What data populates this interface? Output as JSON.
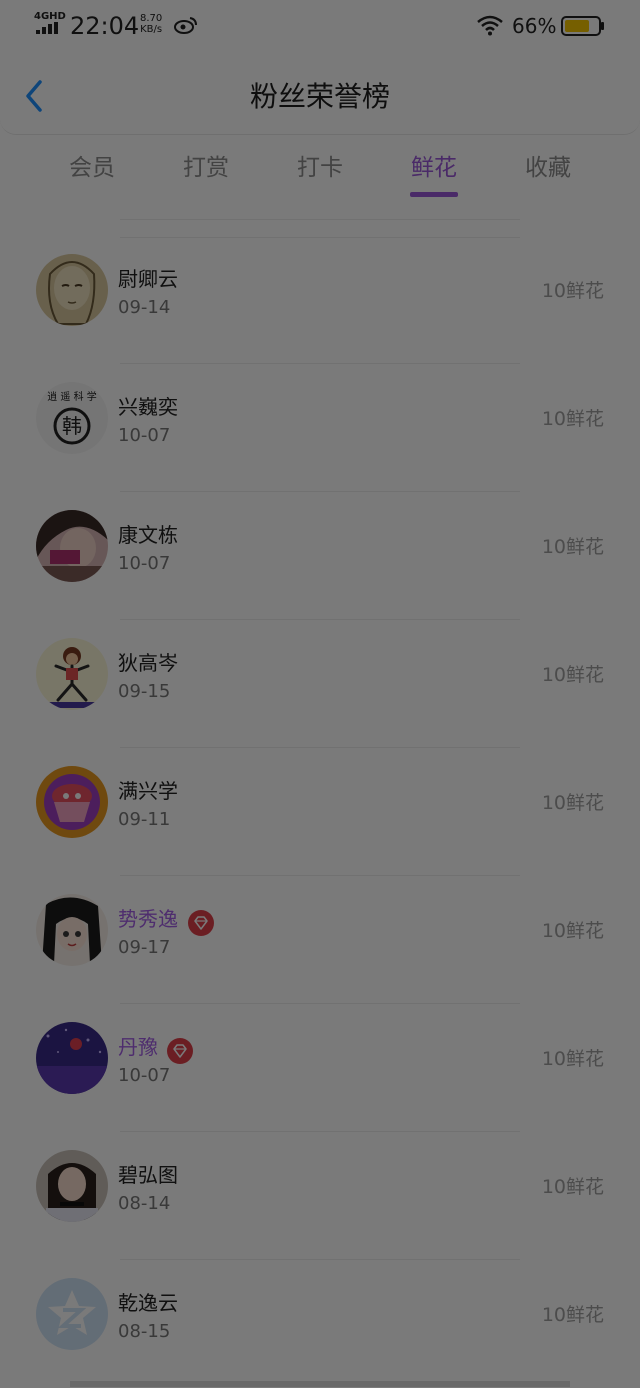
{
  "status_bar": {
    "network": "4GHD",
    "time": "22:04",
    "speed_value": "8.70",
    "speed_unit": "KB/s",
    "battery_percent": "66%"
  },
  "header": {
    "title": "粉丝荣誉榜"
  },
  "tabs": [
    {
      "label": "会员",
      "active": false
    },
    {
      "label": "打赏",
      "active": false
    },
    {
      "label": "打卡",
      "active": false
    },
    {
      "label": "鲜花",
      "active": true
    },
    {
      "label": "收藏",
      "active": false
    }
  ],
  "fans": [
    {
      "name": "尉卿云",
      "date": "09-14",
      "amount": "10鲜花",
      "vip": false,
      "avatar": "sketch-portrait"
    },
    {
      "name": "兴巍奕",
      "date": "10-07",
      "amount": "10鲜花",
      "vip": false,
      "avatar": "calligraphy-logo"
    },
    {
      "name": "康文栋",
      "date": "10-07",
      "amount": "10鲜花",
      "vip": false,
      "avatar": "girl-photo"
    },
    {
      "name": "狄高岑",
      "date": "09-15",
      "amount": "10鲜花",
      "vip": false,
      "avatar": "cartoon-kid"
    },
    {
      "name": "满兴学",
      "date": "09-11",
      "amount": "10鲜花",
      "vip": false,
      "avatar": "cupcake-art"
    },
    {
      "name": "势秀逸",
      "date": "09-17",
      "amount": "10鲜花",
      "vip": true,
      "avatar": "anime-girl"
    },
    {
      "name": "丹豫",
      "date": "10-07",
      "amount": "10鲜花",
      "vip": true,
      "avatar": "purple-night"
    },
    {
      "name": "碧弘图",
      "date": "08-14",
      "amount": "10鲜花",
      "vip": false,
      "avatar": "girl-portrait"
    },
    {
      "name": "乾逸云",
      "date": "08-15",
      "amount": "10鲜花",
      "vip": false,
      "avatar": "default-star"
    }
  ],
  "colors": {
    "accent": "#9b59d9",
    "vip_name": "#a45fe6",
    "vip_badge": "#e0404a",
    "back_arrow": "#1e90ff",
    "battery": "#f7c600"
  }
}
